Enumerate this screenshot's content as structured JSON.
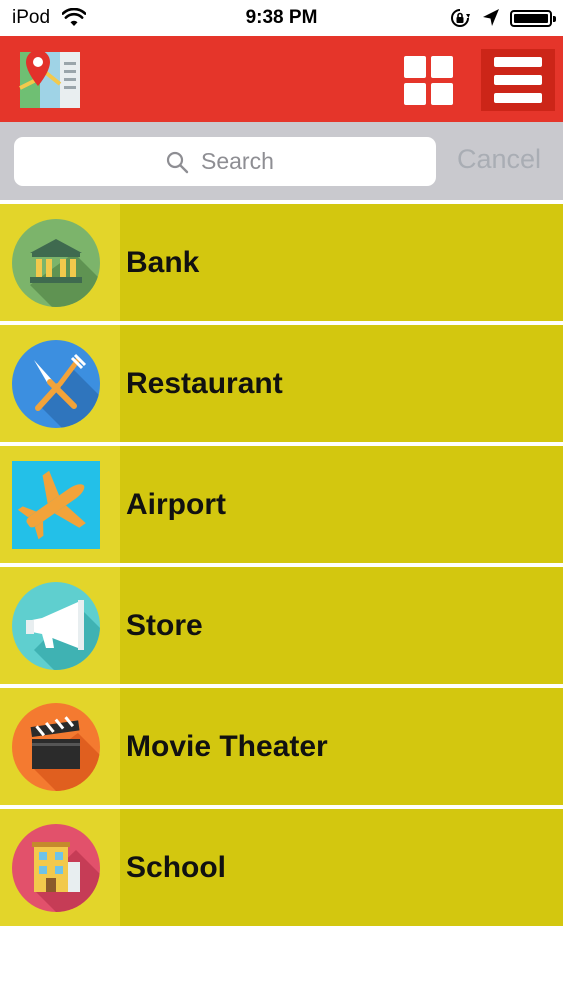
{
  "status_bar": {
    "carrier": "iPod",
    "time": "9:38 PM"
  },
  "header": {
    "logo_icon": "map-pin-icon",
    "grid_icon": "grid-icon",
    "menu_icon": "hamburger-menu-icon",
    "background_color": "#e5352a"
  },
  "search": {
    "placeholder": "Search",
    "cancel_label": "Cancel"
  },
  "categories": [
    {
      "label": "Bank",
      "icon": "bank-icon"
    },
    {
      "label": "Restaurant",
      "icon": "fork-knife-icon"
    },
    {
      "label": "Airport",
      "icon": "airplane-icon"
    },
    {
      "label": "Store",
      "icon": "megaphone-icon"
    },
    {
      "label": "Movie Theater",
      "icon": "clapperboard-icon"
    },
    {
      "label": "School",
      "icon": "school-building-icon"
    }
  ],
  "colors": {
    "row_background": "#d3c70f",
    "icon_cell_background": "#e3d52a"
  }
}
